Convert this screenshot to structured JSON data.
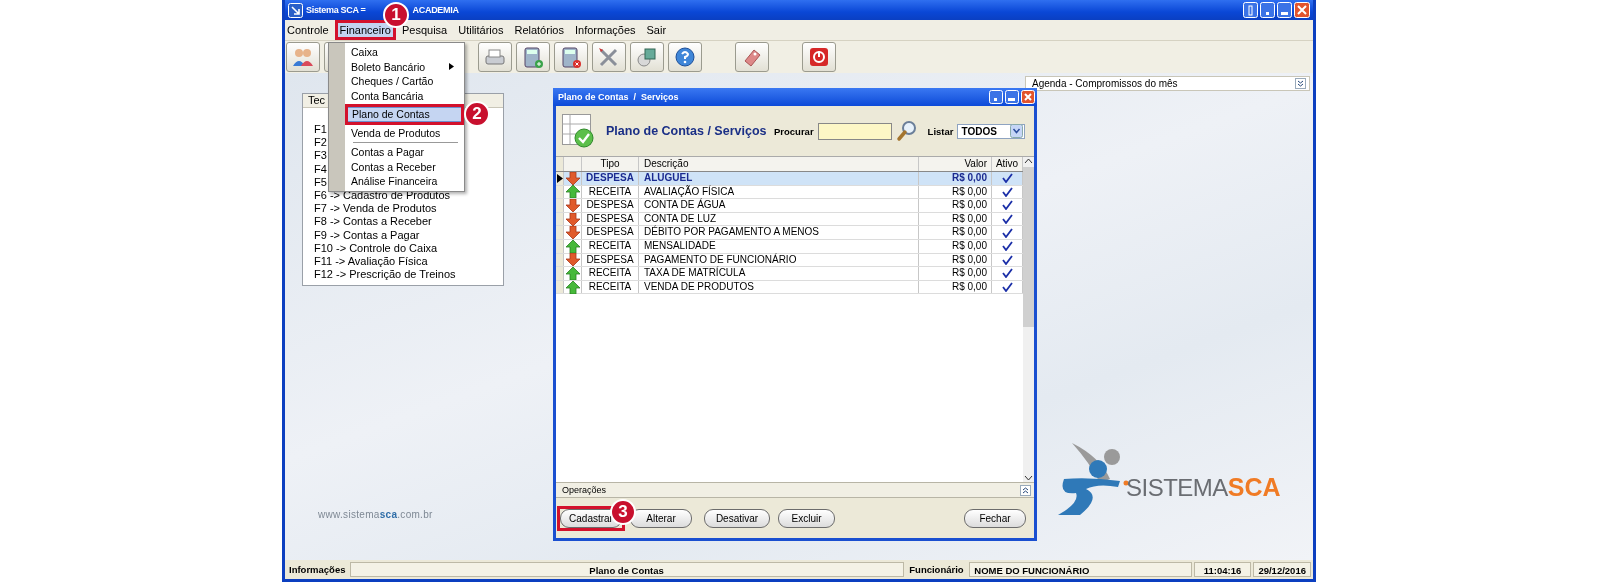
{
  "window": {
    "title_start": "Sistema SCA =",
    "title_end": "ACADEMIA"
  },
  "menu_bar": [
    {
      "label": "Controle",
      "selected": false
    },
    {
      "label": "Financeiro",
      "selected": true
    },
    {
      "label": "Pesquisa",
      "selected": false
    },
    {
      "label": "Utilitários",
      "selected": false
    },
    {
      "label": "Relatórios",
      "selected": false
    },
    {
      "label": "Informações",
      "selected": false
    },
    {
      "label": "Sair",
      "selected": false
    }
  ],
  "financeiro_menu": [
    {
      "kind": "item",
      "label": "Caixa",
      "selected": false
    },
    {
      "kind": "submenu",
      "label": "Boleto Bancário",
      "selected": false
    },
    {
      "kind": "item",
      "label": "Cheques / Cartão",
      "selected": false
    },
    {
      "kind": "item",
      "label": "Conta Bancária",
      "selected": false
    },
    {
      "kind": "item",
      "label": "Plano de Contas",
      "selected": true
    },
    {
      "kind": "item",
      "label": "Venda de Produtos",
      "selected": false
    },
    {
      "kind": "separator"
    },
    {
      "kind": "item",
      "label": "Contas a Pagar",
      "selected": false
    },
    {
      "kind": "item",
      "label": "Contas a Receber",
      "selected": false
    },
    {
      "kind": "item",
      "label": "Análise Financeira",
      "selected": false
    }
  ],
  "shortcuts_panel": {
    "title": "Tec",
    "items": [
      "F1",
      "F2",
      "F3",
      "F4",
      "F5",
      "F6 -> Cadastro de Produtos",
      "F7 -> Venda de Produtos",
      "F8 -> Contas a Receber",
      "F9 -> Contas a Pagar",
      "F10 -> Controle do Caixa",
      "F11 -> Avaliação Física",
      "F12 -> Prescrição de Treinos"
    ]
  },
  "agenda_panel": {
    "title": "Agenda - Compromissos do mês"
  },
  "website": "www.sistema**sca**.com.br",
  "logo": {
    "word1": "SISTEMA",
    "word2": "SCA"
  },
  "dialog": {
    "title": "Plano de Contas  /  Serviços",
    "heading": "Plano de Contas / Serviços",
    "search_label": "Procurar",
    "list_label": "Listar",
    "list_value": "TODOS",
    "table": {
      "columns": [
        "Tipo",
        "Descrição",
        "Valor",
        "Ativo"
      ],
      "rows": [
        {
          "kind": "expense",
          "tipo": "DESPESA",
          "descricao": "ALUGUEL",
          "valor": "R$ 0,00",
          "ativo": true,
          "selected": true
        },
        {
          "kind": "income",
          "tipo": "RECEITA",
          "descricao": "AVALIAÇÃO FÍSICA",
          "valor": "R$ 0,00",
          "ativo": true,
          "selected": false
        },
        {
          "kind": "expense",
          "tipo": "DESPESA",
          "descricao": "CONTA DE ÁGUA",
          "valor": "R$ 0,00",
          "ativo": true,
          "selected": false
        },
        {
          "kind": "expense",
          "tipo": "DESPESA",
          "descricao": "CONTA DE LUZ",
          "valor": "R$ 0,00",
          "ativo": true,
          "selected": false
        },
        {
          "kind": "expense",
          "tipo": "DESPESA",
          "descricao": "DÉBITO POR PAGAMENTO A MENOS",
          "valor": "R$ 0,00",
          "ativo": true,
          "selected": false
        },
        {
          "kind": "income",
          "tipo": "RECEITA",
          "descricao": "MENSALIDADE",
          "valor": "R$ 0,00",
          "ativo": true,
          "selected": false
        },
        {
          "kind": "expense",
          "tipo": "DESPESA",
          "descricao": "PAGAMENTO DE FUNCIONÁRIO",
          "valor": "R$ 0,00",
          "ativo": true,
          "selected": false
        },
        {
          "kind": "income",
          "tipo": "RECEITA",
          "descricao": "TAXA DE MATRÍCULA",
          "valor": "R$ 0,00",
          "ativo": true,
          "selected": false
        },
        {
          "kind": "income",
          "tipo": "RECEITA",
          "descricao": "VENDA DE PRODUTOS",
          "valor": "R$ 0,00",
          "ativo": true,
          "selected": false
        }
      ]
    },
    "section_title": "Operações",
    "buttons": [
      "Cadastrar",
      "Alterar",
      "Desativar",
      "Excluir",
      "Fechar"
    ]
  },
  "status_bar": [
    {
      "kind": "label",
      "text": "Informações"
    },
    {
      "kind": "field",
      "text": "Plano de Contas"
    },
    {
      "kind": "label",
      "text": "Funcionário"
    },
    {
      "kind": "field",
      "text": "NOME DO FUNCIONÁRIO"
    },
    {
      "kind": "field",
      "text": "11:04:16"
    },
    {
      "kind": "field",
      "text": "29/12/2016"
    }
  ],
  "annotations": [
    {
      "number": "1"
    },
    {
      "number": "2"
    },
    {
      "number": "3"
    }
  ]
}
